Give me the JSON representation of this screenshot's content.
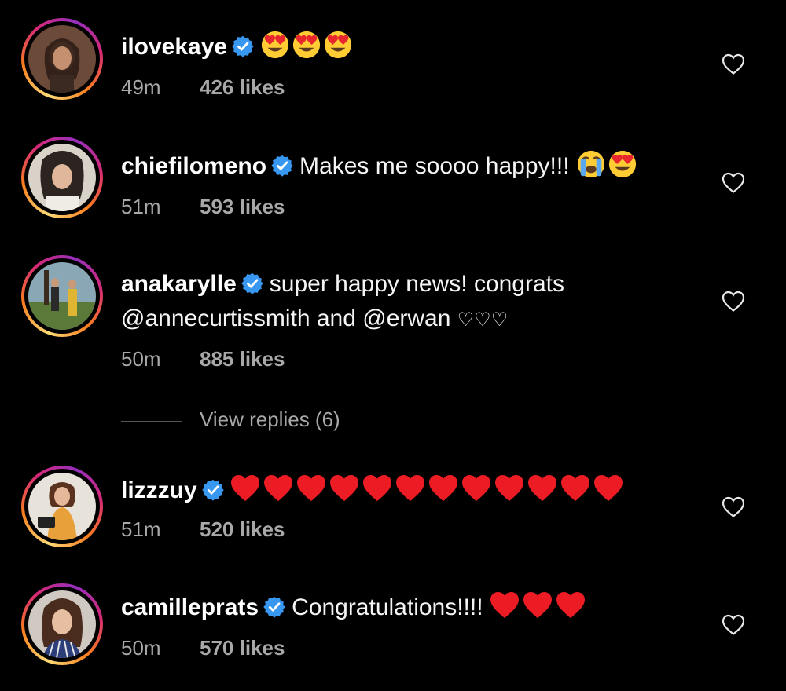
{
  "colors": {
    "background": "#000000",
    "text": "#f5f5f5",
    "meta": "#a8a8a8",
    "verified": "#3897f0",
    "heart": "#ed1c24",
    "emoji_face": "#ffcc33"
  },
  "comments": [
    {
      "username": "ilovekaye",
      "verified": true,
      "text": "",
      "emojis": [
        "heart-eyes",
        "heart-eyes",
        "heart-eyes"
      ],
      "time": "49m",
      "likes": "426 likes"
    },
    {
      "username": "chiefilomeno",
      "verified": true,
      "text": "Makes me soooo happy!!!",
      "emojis": [
        "loudly-crying",
        "heart-eyes"
      ],
      "time": "51m",
      "likes": "593 likes"
    },
    {
      "username": "anakarylle",
      "verified": true,
      "text": "super happy news! congrats",
      "text_line2": "@annecurtissmith and @erwan",
      "text_line2_hearts": "♡♡♡",
      "time": "50m",
      "likes": "885 likes"
    },
    {
      "username": "lizzzuy",
      "verified": true,
      "text": "",
      "red_hearts": 12,
      "time": "51m",
      "likes": "520 likes"
    },
    {
      "username": "camilleprats",
      "verified": true,
      "text": "Congratulations!!!!",
      "red_hearts": 3,
      "time": "50m",
      "likes": "570 likes"
    }
  ],
  "view_replies": "View replies (6)",
  "icons": {
    "like": "heart-outline-icon",
    "verified": "verified-badge-icon"
  }
}
